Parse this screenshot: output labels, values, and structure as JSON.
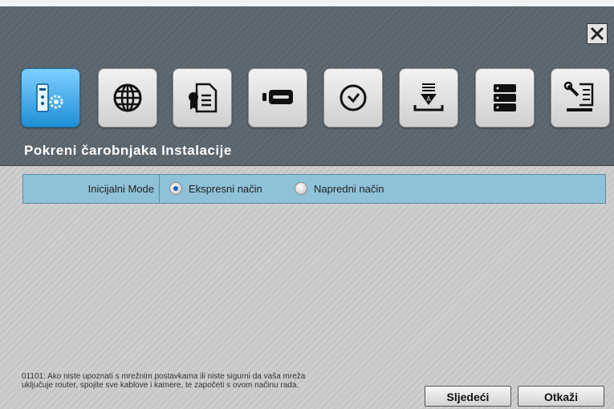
{
  "title": "Pokreni čarobnjaka Instalacije",
  "toolbar": {
    "items": [
      {
        "icon": "setup-wizard-icon",
        "active": true
      },
      {
        "icon": "globe-icon",
        "active": false
      },
      {
        "icon": "certificate-icon",
        "active": false
      },
      {
        "icon": "camera-recorder-icon",
        "active": false
      },
      {
        "icon": "clock-icon",
        "active": false
      },
      {
        "icon": "download-install-icon",
        "active": false
      },
      {
        "icon": "storage-server-icon",
        "active": false
      },
      {
        "icon": "tools-icon",
        "active": false
      }
    ]
  },
  "mode": {
    "label": "Inicijalni Mode",
    "options": [
      {
        "label": "Ekspresni način",
        "selected": true
      },
      {
        "label": "Napredni način",
        "selected": false
      }
    ]
  },
  "note": "01101: Ako niste upoznati s mrežnim postavkama ili niste sigurni da vaša mreža uključuje router, spojite sve kablove i kamere, te započeti s ovom načinu rada.",
  "buttons": {
    "next": "Sljedeći",
    "cancel": "Otkaži"
  },
  "colors": {
    "header": "#5e6870",
    "active_tab": "#2a9ae0",
    "mode_row": "#8fc2d8"
  }
}
